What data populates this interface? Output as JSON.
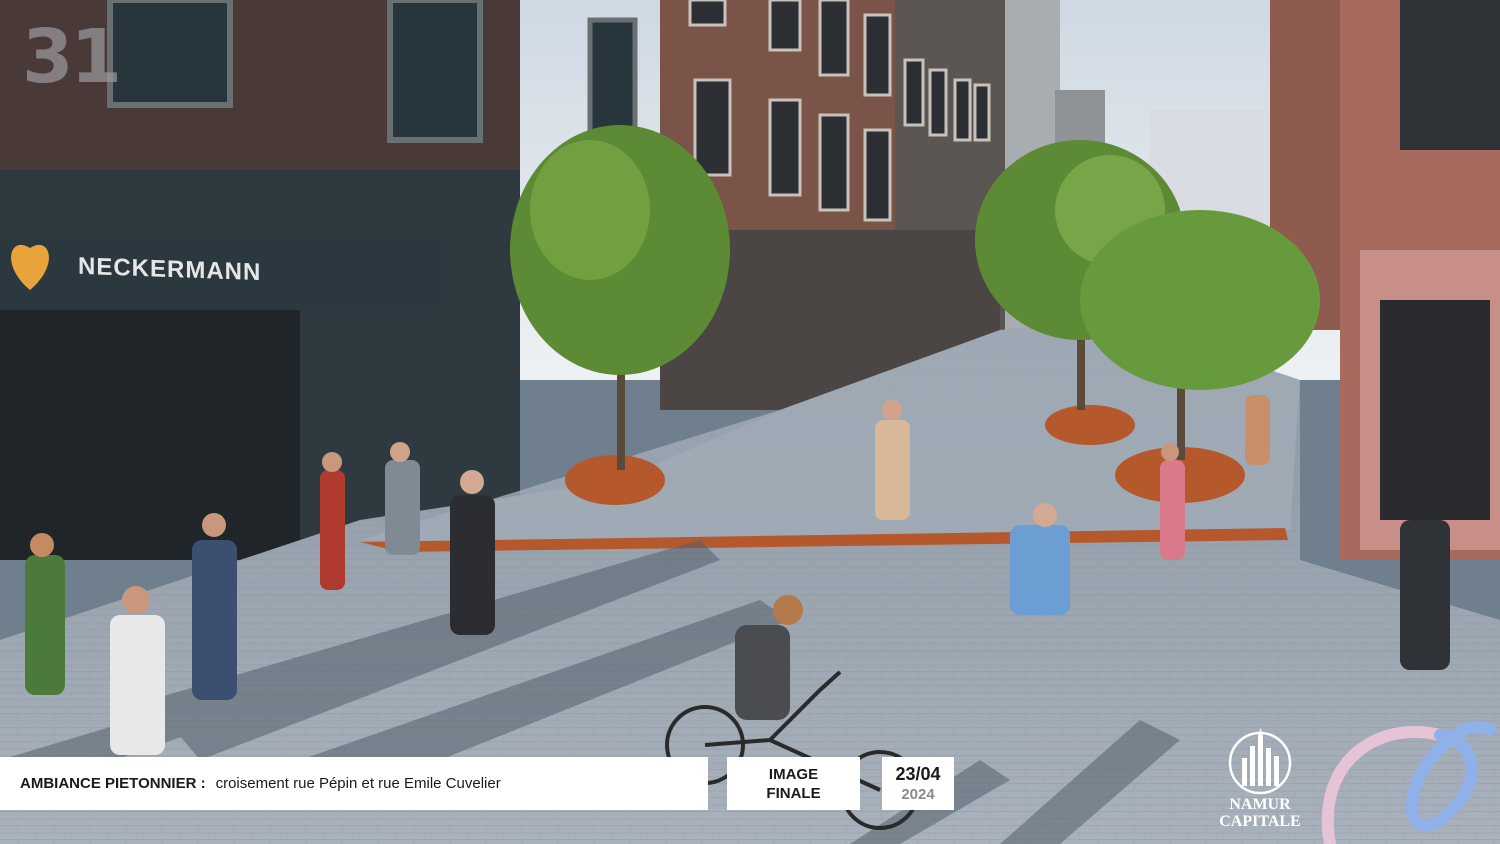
{
  "slide": {
    "number": "31"
  },
  "scene": {
    "shop_sign": "NECKERMANN"
  },
  "caption": {
    "title": "AMBIANCE PIETONNIER :",
    "text": "croisement rue Pépin et rue Emile Cuvelier"
  },
  "status": {
    "line1": "IMAGE",
    "line2": "FINALE"
  },
  "date": {
    "day": "23/04",
    "year": "2024"
  },
  "brand": {
    "line1": "NAMUR",
    "line2": "CAPITALE"
  },
  "colors": {
    "accent": "#b5582c",
    "sky": "#dfe6ec",
    "pavement": "#9fa9b4",
    "foliage": "#5d8a35",
    "swirl_pink": "#e7c3d8",
    "swirl_blue": "#8fb0e8"
  }
}
